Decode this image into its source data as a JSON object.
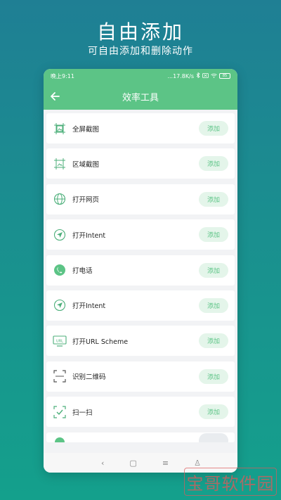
{
  "promo": {
    "headline": "自由添加",
    "subline": "可自由添加和删除动作"
  },
  "status": {
    "time": "晚上9:11",
    "speed": "...17.8K/s",
    "icons": [
      "bluetooth-icon",
      "sim-icon",
      "wifi-icon"
    ],
    "battery": "85"
  },
  "appbar": {
    "title": "效率工具",
    "color": "#5cc486"
  },
  "items": [
    {
      "label": "全屏截图",
      "icon": "fullscreen-screenshot-icon",
      "button": "添加"
    },
    {
      "label": "区域截图",
      "icon": "area-screenshot-icon",
      "button": "添加"
    },
    {
      "label": "打开网页",
      "icon": "globe-icon",
      "button": "添加"
    },
    {
      "label": "打开Intent",
      "icon": "send-icon",
      "button": "添加"
    },
    {
      "label": "打电话",
      "icon": "phone-icon",
      "button": "添加"
    },
    {
      "label": "打开Intent",
      "icon": "send-icon",
      "button": "添加"
    },
    {
      "label": "打开URL Scheme",
      "icon": "url-icon",
      "button": "添加"
    },
    {
      "label": "识别二维码",
      "icon": "scan-frame-icon",
      "button": "添加"
    },
    {
      "label": "扫一扫",
      "icon": "scan-check-icon",
      "button": "添加"
    }
  ],
  "navbar": {
    "back": "‹",
    "home": "▢",
    "menu": "≡",
    "accessibility": "♙"
  },
  "watermark": "宝哥软件园"
}
